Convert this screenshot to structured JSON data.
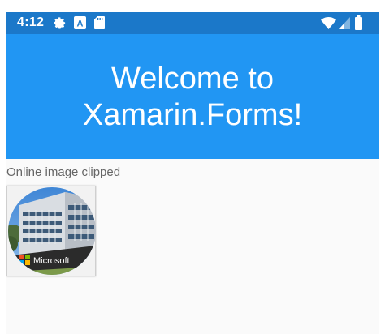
{
  "status_bar": {
    "time": "4:12",
    "left_icons": [
      "gear-icon",
      "a-badge-icon",
      "sd-card-icon"
    ],
    "right_icons": [
      "wifi-icon",
      "cell-signal-icon",
      "battery-icon"
    ],
    "color": "#1b78c9"
  },
  "header": {
    "title_line1": "Welcome to",
    "title_line2": "Xamarin.Forms!",
    "color": "#2196f3"
  },
  "content": {
    "caption": "Online image clipped",
    "image_text": "Microsoft"
  }
}
